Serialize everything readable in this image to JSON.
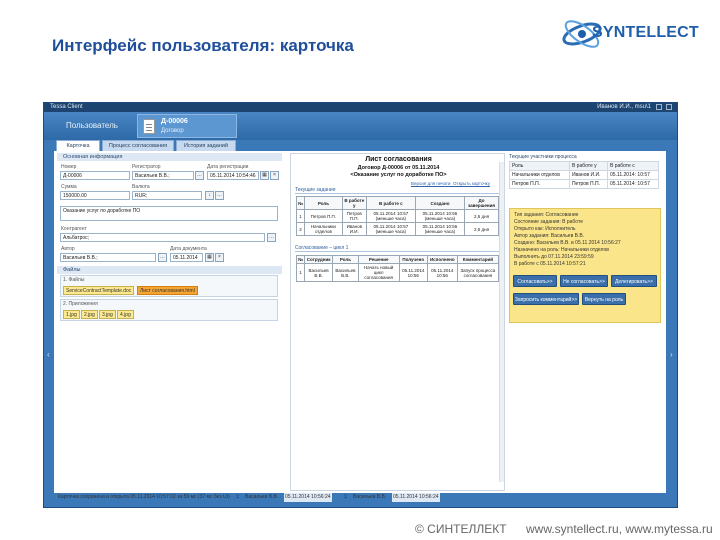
{
  "slide": {
    "title": "Интерфейс пользователя: карточка",
    "logo_text": "SYNTELLECT",
    "footer_left": "© СИНТЕЛЛЕКТ",
    "footer_right": "www.syntellect.ru, www.mytessa.ru"
  },
  "colors": {
    "title": "#1f4e9a",
    "window_blue": "#2f6aa8",
    "note_yellow": "#fbe58a",
    "file_highlight": "#f6a532"
  },
  "window": {
    "title": "Tessa Client",
    "user_text": "Иванов И.И., msu\\1",
    "header_user": "Пользователь",
    "doc_number": "Д-00006",
    "doc_type": "Договор"
  },
  "tabs": [
    "Карточка",
    "Процесс согласования",
    "История заданий"
  ],
  "form": {
    "section_main": "Основная информация",
    "number_label": "Номер",
    "number_value": "Д-00006",
    "registrar_label": "Регистратор",
    "registrar_value": "Васильев В.В.;",
    "reg_date_label": "Дата регистрации",
    "reg_date_value": "05.11.2014  10:54:46",
    "sum_label": "Сумма",
    "sum_value": "150000.00",
    "currency_label": "Валюта",
    "currency_value": "RUR;",
    "subject_value": "Оказание услуг по доработке ПО",
    "contractor_label": "Контрагент",
    "contractor_value": "Альбатрос;",
    "author_label": "Автор",
    "author_value": "Васильев В.В.;",
    "doc_date_label": "Дата документа",
    "doc_date_value": "05.11.2014",
    "section_files": "Файлы",
    "group1": "1. Файлы",
    "file1": "ServiceContractTemplate.doc",
    "file2": "Лист согласования.html",
    "group2": "2. Приложения",
    "attachments": [
      "1.jpg",
      "2.jpg",
      "3.jpg",
      "4.jpg"
    ]
  },
  "sheet": {
    "title": "Лист согласования",
    "subtitle1": "Договор Д-00006 от 05.11.2014",
    "subtitle2": "<Оказание услуг по доработке ПО>",
    "link1": "Версия для печати",
    "link2": "Открыть карточку",
    "current_tasks": "Текущие задания",
    "tasks_headers": [
      "№",
      "Роль",
      "В работе у",
      "В работе с",
      "Создано",
      "До завершения"
    ],
    "tasks_rows": [
      [
        "1",
        "Петров П.П.",
        "Петров П.П.",
        "05.11.2014 10:57 (меньше часа)",
        "05.11.2014 10:56 (меньше часа)",
        "2,5 дня"
      ],
      [
        "2",
        "Начальники отделов",
        "Иванов И.И.",
        "05.11.2014 10:57 (меньше часа)",
        "05.11.2014 10:56 (меньше часа)",
        "2,5 дня"
      ]
    ],
    "cycle_title": "Согласование – цикл 1",
    "cycle_headers": [
      "№",
      "Сотрудник",
      "Роль",
      "Решение",
      "Получено",
      "Исполнено",
      "Комментарий"
    ],
    "cycle_rows": [
      [
        "1",
        "Васильев В.В.",
        "Васильев В.В.",
        "Начать новый цикл согласования",
        "05.11.2014 10:56",
        "05.11.2014 10:56",
        "Запуск процесса согласования"
      ]
    ]
  },
  "participants": {
    "label": "Текущие участники процесса",
    "headers": [
      "Роль",
      "В работе у",
      "В работе с"
    ],
    "rows": [
      [
        "Начальники отделов",
        "Иванов И.И.",
        "05.11.2014: 10:57"
      ],
      [
        "Петров П.П.",
        "Петров П.П.",
        "05.11.2014: 10:57"
      ]
    ]
  },
  "task": {
    "lines": [
      "Тип задания: Согласование",
      "Состояние задания: В работе",
      "Открыто как: Исполнитель",
      "Автор задания: Васильев В.В.",
      "Создано: Васильев В.В. в 05.11.2014 10:56:27",
      "Назначено на роль: Начальники отделов",
      "Выполнить до 07.11.2014 23:59:59",
      "В работе с 05.11.2014 10:57:21"
    ],
    "btn_approve": "Согласовать>>",
    "btn_reject": "Не согласовать>>",
    "btn_delegate": "Делегировать>>",
    "btn_comment": "Запросить комментарий>>",
    "btn_return": "Вернуть на роль"
  },
  "status": {
    "text": "Карточка сохранена и открыта 05.11.2014 10:57:02 за 59 мс (37 мс без UI)",
    "label1": "1:",
    "val1": "Васильев В.В.",
    "val1_time": "05.11.2014 10:56:24",
    "label2": "1:",
    "val2": "Васильев В.В.",
    "val2_time": "05.11.2014 10:56:24"
  }
}
